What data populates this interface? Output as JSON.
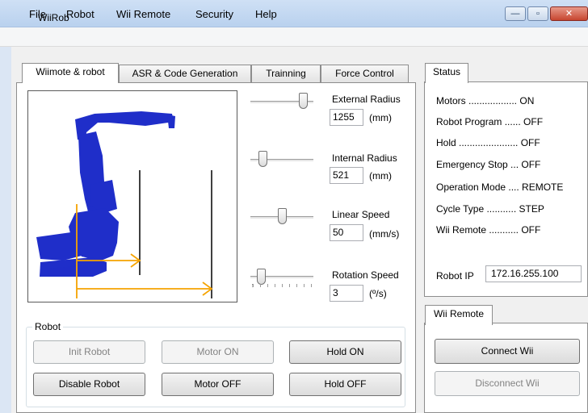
{
  "window": {
    "title": "WiiRob",
    "minimize_glyph": "—",
    "maximize_glyph": "▫",
    "close_glyph": "✕"
  },
  "menu": [
    "File",
    "Robot",
    "Wii Remote",
    "Security",
    "Help"
  ],
  "tabs": [
    "Wiimote & robot",
    "ASR & Code Generation",
    "Trainning",
    "Force Control"
  ],
  "controls": {
    "external_radius": {
      "label": "External Radius",
      "value": "1255",
      "unit": "(mm)",
      "slider_fraction": 0.9
    },
    "internal_radius": {
      "label": "Internal Radius",
      "value": "521",
      "unit": "(mm)",
      "slider_fraction": 0.15
    },
    "linear_speed": {
      "label": "Linear Speed",
      "value": "50",
      "unit": "(mm/s)",
      "slider_fraction": 0.5
    },
    "rotation_speed": {
      "label": "Rotation Speed",
      "value": "3",
      "unit": "(º/s)",
      "slider_fraction": 0.12
    }
  },
  "robot_group": {
    "legend": "Robot",
    "buttons": [
      [
        "Init Robot",
        "Motor ON",
        "Hold ON"
      ],
      [
        "Disable Robot",
        "Motor OFF",
        "Hold OFF"
      ]
    ]
  },
  "status": {
    "tab": "Status",
    "lines": [
      "Motors .................. ON",
      "Robot Program ...... OFF",
      "Hold ...................... OFF",
      "Emergency Stop ... OFF",
      "Operation Mode .... REMOTE",
      "Cycle Type ........... STEP",
      "Wii Remote ........... OFF"
    ],
    "robot_ip_label": "Robot IP",
    "robot_ip_value": "172.16.255.100"
  },
  "wii_panel": {
    "tab": "Wii Remote",
    "connect_label": "Connect Wii",
    "disconnect_label": "Disconnect Wii"
  },
  "colors": {
    "robot": "#1f2ec9",
    "arrow": "#f5a300"
  }
}
